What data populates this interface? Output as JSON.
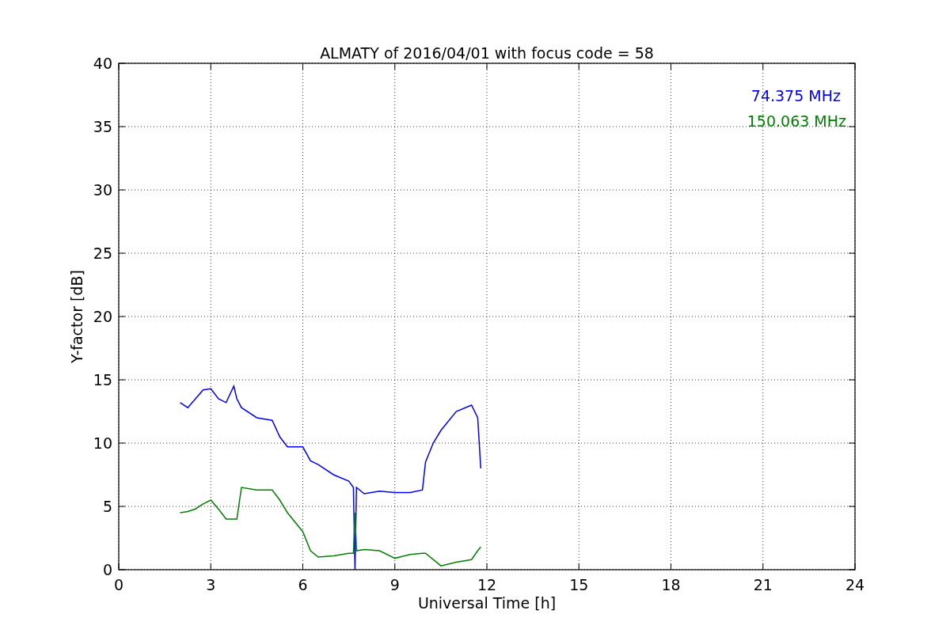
{
  "chart_data": {
    "type": "line",
    "title": "ALMATY of 2016/04/01 with focus code = 58",
    "xlabel": "Universal Time [h]",
    "ylabel": "Y-factor [dB]",
    "x": [
      2.0,
      2.25,
      2.5,
      2.75,
      3.0,
      3.25,
      3.5,
      3.75,
      3.85,
      4.0,
      4.5,
      5.0,
      5.25,
      5.5,
      6.0,
      6.25,
      6.5,
      7.0,
      7.5,
      7.65,
      7.7,
      7.75,
      8.0,
      8.5,
      9.0,
      9.5,
      9.9,
      10.0,
      10.25,
      10.5,
      11.0,
      11.5,
      11.7,
      11.8
    ],
    "series": [
      {
        "name": "74.375 MHz",
        "color": "#0000ff",
        "values": [
          13.2,
          12.8,
          13.5,
          14.2,
          14.3,
          13.5,
          13.2,
          14.5,
          13.5,
          12.8,
          12.0,
          11.8,
          10.5,
          9.7,
          9.7,
          8.6,
          8.3,
          7.5,
          7.0,
          6.5,
          0.0,
          6.5,
          6.0,
          6.2,
          6.1,
          6.1,
          6.3,
          8.5,
          10.0,
          11.0,
          12.5,
          13.0,
          12.0,
          8.0
        ]
      },
      {
        "name": "150.063 MHz",
        "color": "#008000",
        "values": [
          4.5,
          4.6,
          4.8,
          5.2,
          5.5,
          4.8,
          4.0,
          4.0,
          4.0,
          6.5,
          6.3,
          6.3,
          5.5,
          4.5,
          3.0,
          1.5,
          1.0,
          1.1,
          1.3,
          1.3,
          4.5,
          1.5,
          1.6,
          1.5,
          0.9,
          1.2,
          1.3,
          1.3,
          0.8,
          0.3,
          0.6,
          0.8,
          1.5,
          1.8
        ]
      }
    ],
    "xlim": [
      0,
      24
    ],
    "ylim": [
      0,
      40
    ],
    "xticks": [
      0,
      3,
      6,
      9,
      12,
      15,
      18,
      21,
      24
    ],
    "yticks": [
      0,
      5,
      10,
      15,
      20,
      25,
      30,
      35,
      40
    ],
    "grid": true
  }
}
